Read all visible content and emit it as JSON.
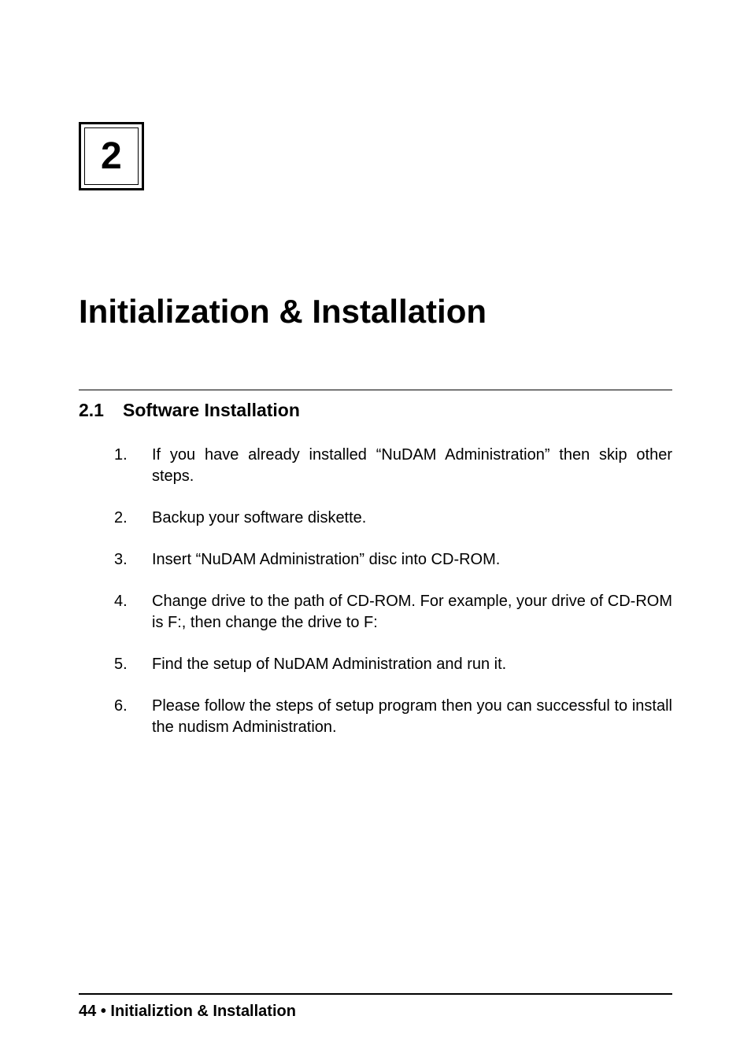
{
  "chapter": {
    "number": "2",
    "title": "Initialization & Installation"
  },
  "section": {
    "number": "2.1",
    "title": "Software Installation"
  },
  "steps": [
    {
      "number": "1.",
      "text": "If you have already installed “NuDAM Administration” then skip other steps."
    },
    {
      "number": "2.",
      "text": "Backup your software diskette."
    },
    {
      "number": "3.",
      "text": "Insert “NuDAM Administration” disc into CD-ROM."
    },
    {
      "number": "4.",
      "text": "Change drive to the path of CD-ROM. For example, your drive of CD-ROM is F:, then change the drive to F:"
    },
    {
      "number": "5.",
      "text": "Find the setup of NuDAM Administration and run it."
    },
    {
      "number": "6.",
      "text": "Please follow the steps of setup program then you can successful to install the nudism Administration."
    }
  ],
  "footer": {
    "page": "44",
    "bullet": "•",
    "text": "Initializtion & Installation"
  }
}
